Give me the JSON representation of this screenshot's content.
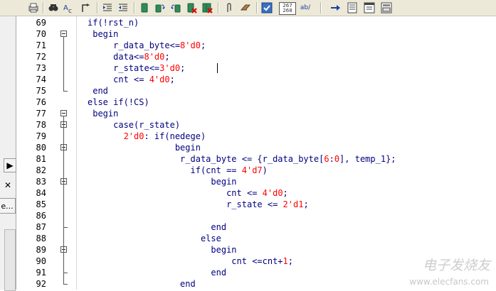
{
  "toolbar": {
    "icons": [
      "print-icon",
      "find-icon",
      "replace-icon",
      "goto-icon",
      "indent-icon",
      "outdent-icon",
      "bookmark-toggle-icon",
      "bookmark-next-icon",
      "bookmark-prev-icon",
      "bookmark-clear-icon",
      "bookmark-clear-all-icon",
      "attach-icon",
      "eraser-icon",
      "check-icon",
      "line-numbers-icon",
      "spell-icon",
      "arrow-right-icon",
      "page-icon",
      "window-icon",
      "panel-icon"
    ],
    "line_numbers_label_top": "267",
    "line_numbers_label_bottom": "268",
    "spell_label": "ab/"
  },
  "left_panel": {
    "arrow": "▶",
    "close": "✕",
    "truncated_button": "e..."
  },
  "editor": {
    "lines": [
      {
        "n": "69",
        "code": "if(!rst_n)"
      },
      {
        "n": "70",
        "code": " begin"
      },
      {
        "n": "71",
        "code": "     r_data_byte<=8'd0;"
      },
      {
        "n": "72",
        "code": "     data<=8'd0;"
      },
      {
        "n": "73",
        "code": "     r_state<=3'd0;"
      },
      {
        "n": "74",
        "code": "     cnt <= 4'd0;"
      },
      {
        "n": "75",
        "code": " end"
      },
      {
        "n": "76",
        "code": "else if(!CS)"
      },
      {
        "n": "77",
        "code": " begin"
      },
      {
        "n": "78",
        "code": "     case(r_state)"
      },
      {
        "n": "79",
        "code": "       2'd0: if(nedege)"
      },
      {
        "n": "80",
        "code": "                 begin"
      },
      {
        "n": "81",
        "code": "                  r_data_byte <= {r_data_byte[6:0], temp_1};"
      },
      {
        "n": "82",
        "code": "                    if(cnt == 4'd7)"
      },
      {
        "n": "83",
        "code": "                        begin"
      },
      {
        "n": "84",
        "code": "                           cnt <= 4'd0;"
      },
      {
        "n": "85",
        "code": "                           r_state <= 2'd1;"
      },
      {
        "n": "86",
        "code": ""
      },
      {
        "n": "87",
        "code": "                        end"
      },
      {
        "n": "88",
        "code": "                      else"
      },
      {
        "n": "89",
        "code": "                        begin"
      },
      {
        "n": "90",
        "code": "                            cnt <=cnt+1;"
      },
      {
        "n": "91",
        "code": "                        end"
      },
      {
        "n": "92",
        "code": "                  end"
      }
    ]
  },
  "watermark": {
    "text": "电子发烧友",
    "url": "www.elecfans.com"
  }
}
